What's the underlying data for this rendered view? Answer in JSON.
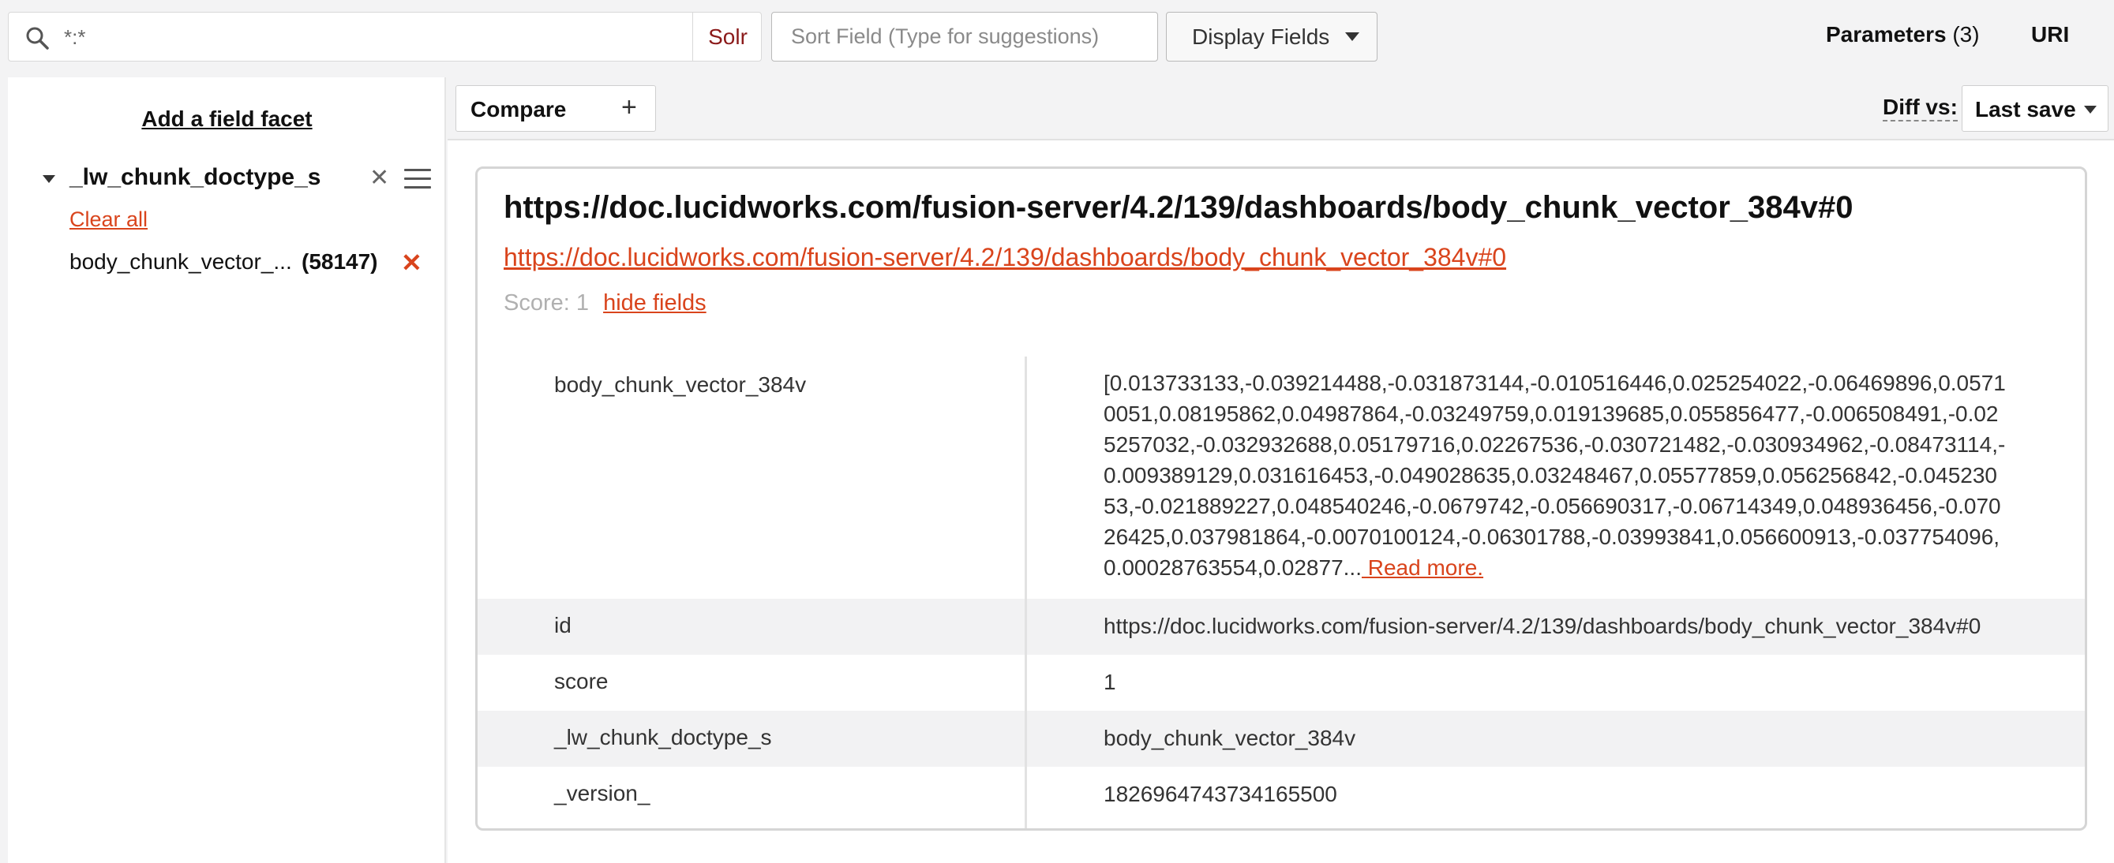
{
  "search": {
    "value": "*:*",
    "mode_label": "Solr"
  },
  "sort_field": {
    "placeholder": "Sort Field (Type for suggestions)"
  },
  "display_fields": {
    "label": "Display Fields"
  },
  "parameters": {
    "label": "Parameters",
    "count": "(3)"
  },
  "uri": {
    "label": "URI"
  },
  "sidebar": {
    "add_facet": "Add a field facet",
    "facet": {
      "name": "_lw_chunk_doctype_s",
      "clear_all": "Clear all",
      "value": {
        "label": "body_chunk_vector_...",
        "count": "(58147)"
      }
    }
  },
  "toolbar": {
    "compare_label": "Compare",
    "diff_label": "Diff vs:",
    "diff_value": "Last save"
  },
  "result": {
    "title": "https://doc.lucidworks.com/fusion-server/4.2/139/dashboards/body_chunk_vector_384v#0",
    "link": "https://doc.lucidworks.com/fusion-server/4.2/139/dashboards/body_chunk_vector_384v#0",
    "score": "Score: 1",
    "hide_fields": "hide fields",
    "fields": [
      {
        "name": "body_chunk_vector_384v",
        "value": "[0.013733133,-0.039214488,-0.031873144,-0.010516446,0.025254022,-0.06469896,0.05710051,0.08195862,0.04987864,-0.03249759,0.019139685,0.055856477,-0.006508491,-0.025257032,-0.032932688,0.05179716,0.02267536,-0.030721482,-0.030934962,-0.08473114,-0.009389129,0.031616453,-0.049028635,0.03248467,0.05577859,0.056256842,-0.04523053,-0.021889227,0.048540246,-0.0679742,-0.056690317,-0.06714349,0.048936456,-0.07026425,0.037981864,-0.0070100124,-0.06301788,-0.03993841,0.056600913,-0.037754096,0.00028763554,0.02877...",
        "read_more": " Read more."
      },
      {
        "name": "id",
        "value": "https://doc.lucidworks.com/fusion-server/4.2/139/dashboards/body_chunk_vector_384v#0"
      },
      {
        "name": "score",
        "value": "1"
      },
      {
        "name": "_lw_chunk_doctype_s",
        "value": "body_chunk_vector_384v"
      },
      {
        "name": "_version_",
        "value": "1826964743734165500"
      }
    ]
  }
}
